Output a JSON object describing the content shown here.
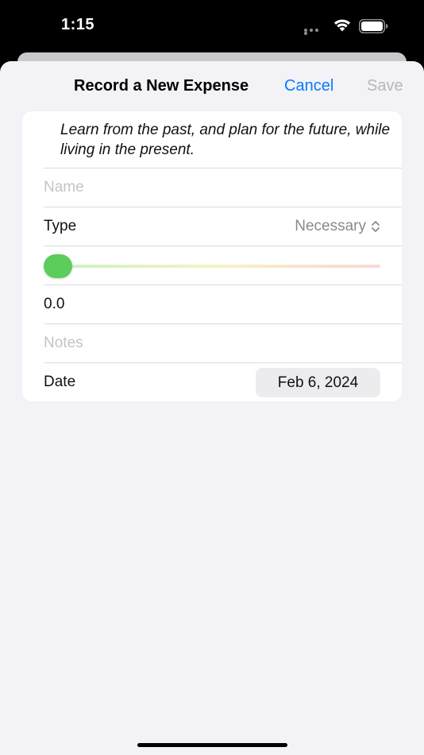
{
  "status_bar": {
    "time": "1:15",
    "icons": [
      "signal-dots-icon",
      "wifi-icon",
      "battery-icon"
    ]
  },
  "nav": {
    "title": "Record a New Expense",
    "cancel_label": "Cancel",
    "save_label": "Save"
  },
  "form": {
    "quote": "Learn from the past, and plan for the future, while living in the present.",
    "name_placeholder": "Name",
    "type_label": "Type",
    "type_value": "Necessary",
    "slider_value": 0,
    "amount_value": "0.0",
    "notes_placeholder": "Notes",
    "date_label": "Date",
    "date_value": "Feb 6, 2024"
  },
  "colors": {
    "accent": "#0a7aff",
    "disabled": "#b6b6bb",
    "slider_thumb": "#5ccc5a",
    "sheet_background": "#f2f2f7"
  }
}
